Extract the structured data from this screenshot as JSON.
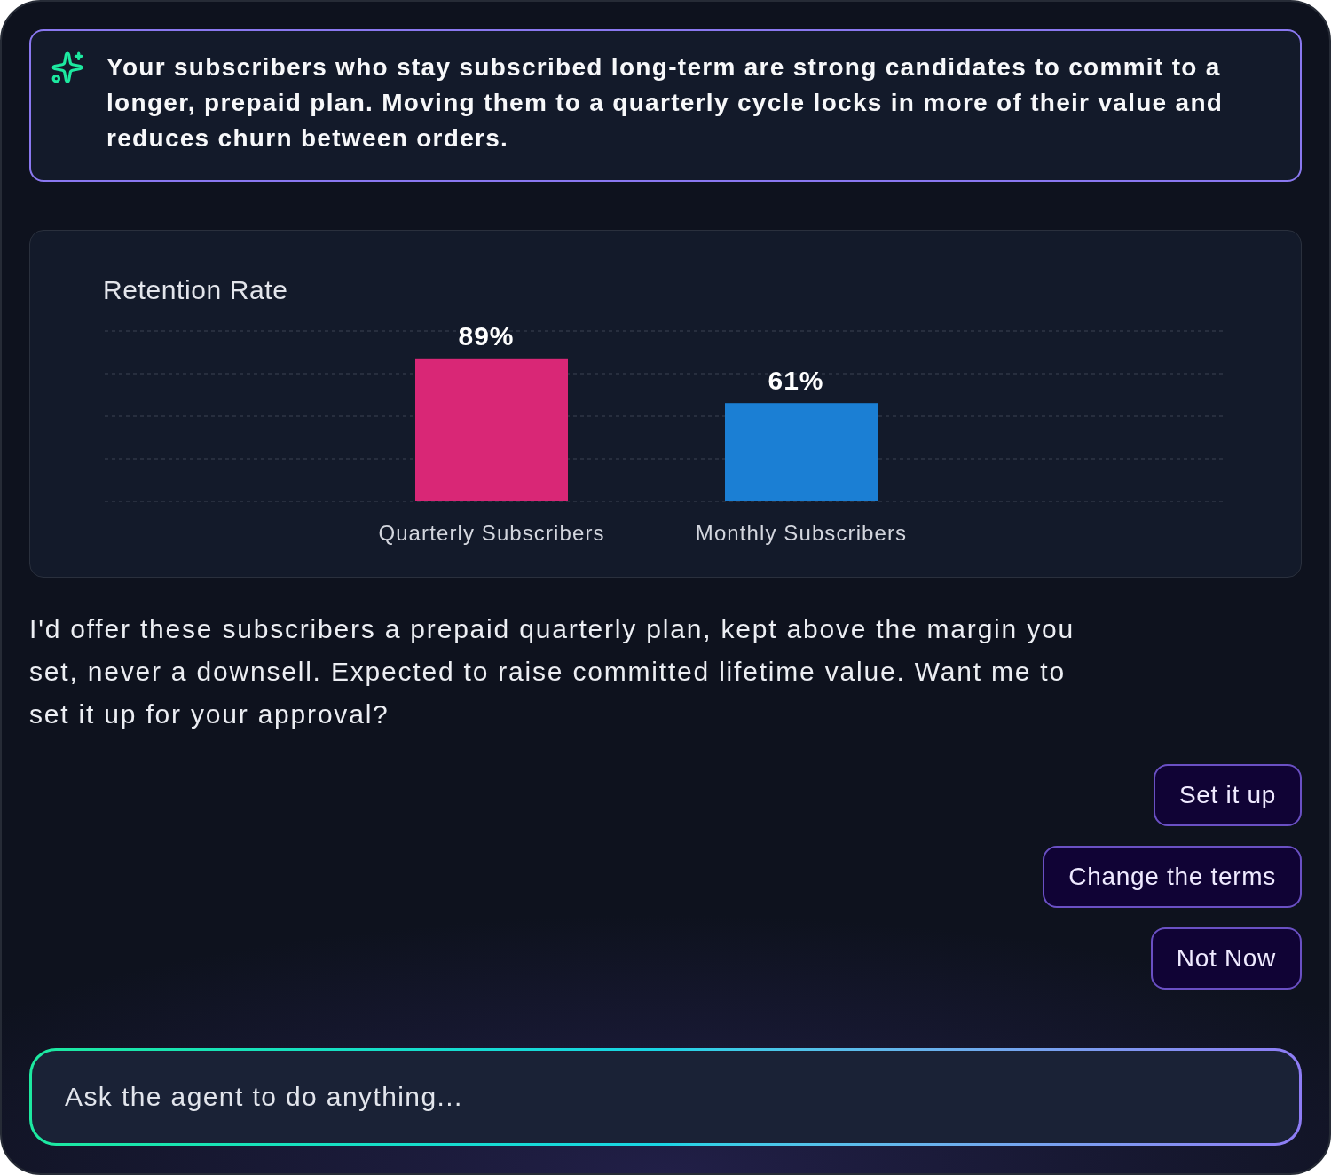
{
  "insight_banner": {
    "text": "Your subscribers who stay subscribed long-term are strong candidates to commit to a longer, prepaid plan. Moving them to a quarterly cycle locks in more of their value and reduces churn between orders."
  },
  "retention_chart": {
    "chart_data": {
      "type": "bar",
      "title": "Retention Rate",
      "categories": [
        "Quarterly Subscribers",
        "Monthly Subscribers"
      ],
      "values": [
        89,
        61
      ],
      "colors": [
        "#d92776",
        "#1b7fd4"
      ],
      "value_labels": [
        "89%",
        "61%"
      ]
    }
  },
  "message": {
    "text": "I'd offer these subscribers a prepaid quarterly plan, kept above the margin you set, never a downsell. Expected to raise committed lifetime value. Want me to set it up for your approval?"
  },
  "actions": [
    {
      "label": "Set it up"
    },
    {
      "label": "Change the terms"
    },
    {
      "label": "Not Now"
    }
  ],
  "composer": {
    "placeholder": "Ask the agent to do anything..."
  }
}
